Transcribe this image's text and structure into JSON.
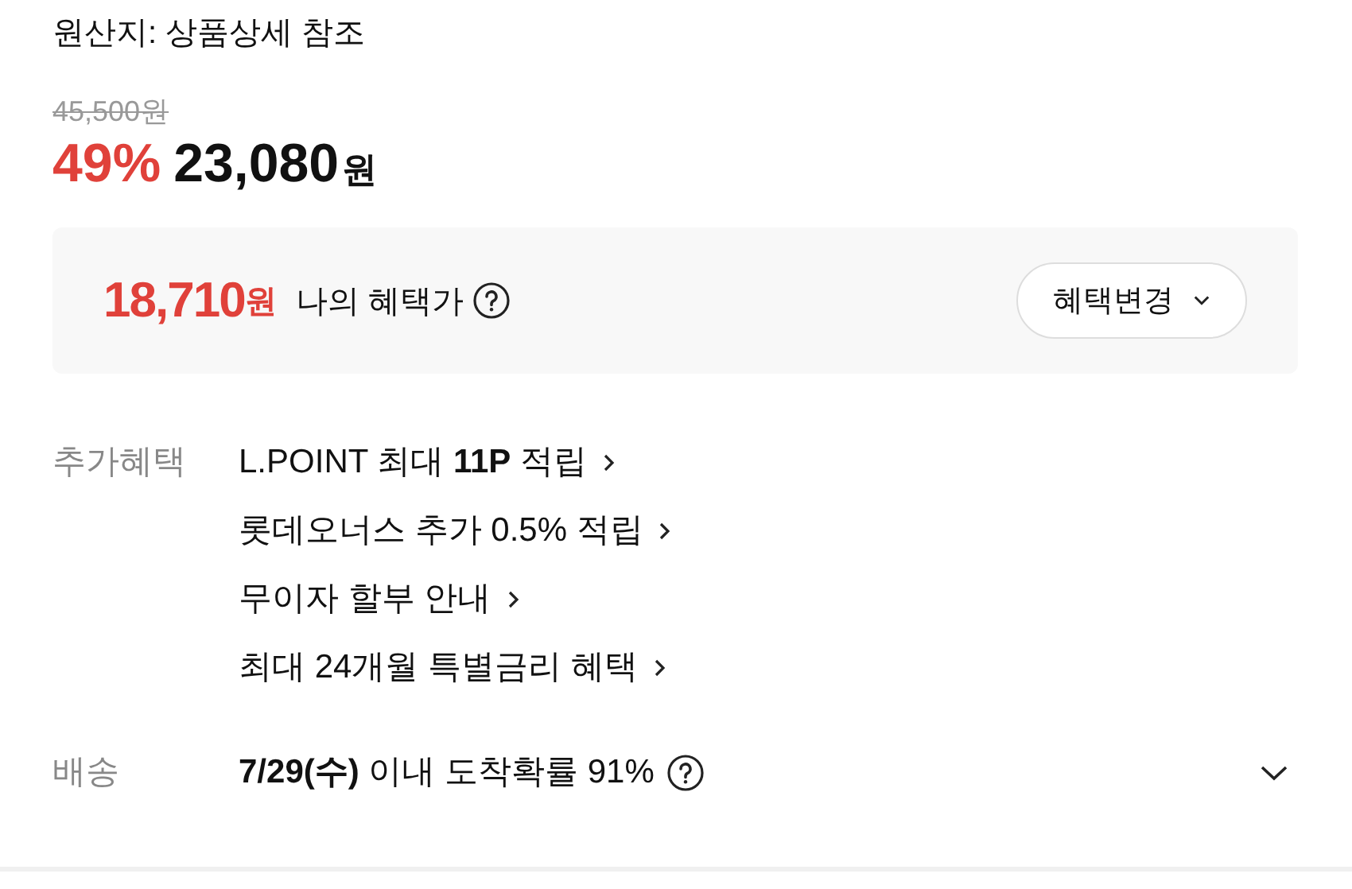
{
  "origin": "원산지: 상품상세 참조",
  "price": {
    "original": "45,500원",
    "discount": "49%",
    "amount": "23,080",
    "unit": "원"
  },
  "benefit_price": {
    "amount": "18,710",
    "unit": "원",
    "label": "나의 혜택가",
    "button": "혜택변경"
  },
  "extra_benefits": {
    "label": "추가혜택",
    "items": [
      {
        "text": "L.POINT 최대 **11P** 적립"
      },
      {
        "text": "롯데오너스 추가 0.5% 적립"
      },
      {
        "text": "무이자 할부 안내"
      },
      {
        "text": "최대 24개월 특별금리 혜택"
      }
    ]
  },
  "delivery": {
    "label": "배송",
    "text": "**7/29(수)** 이내 도착확률 91%"
  }
}
